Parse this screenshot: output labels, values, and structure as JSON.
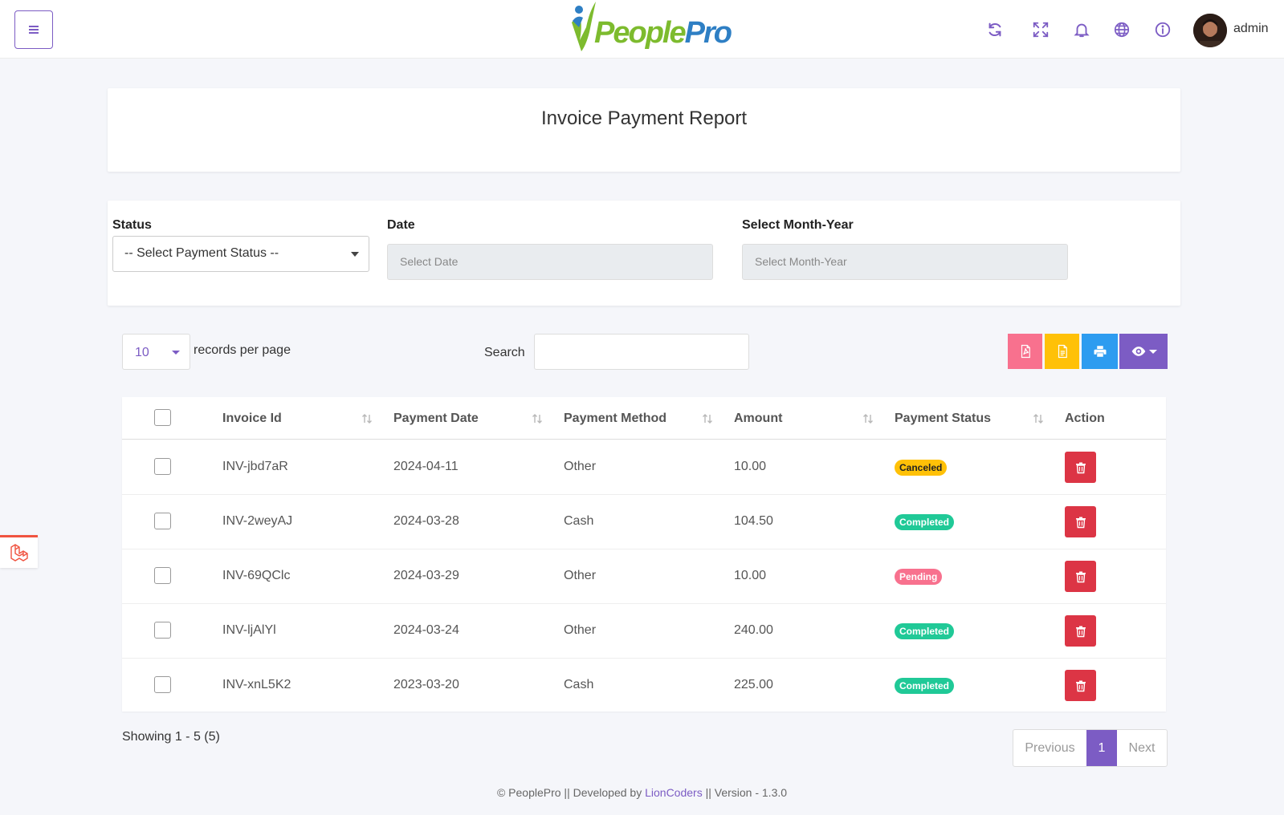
{
  "header": {
    "brand_part1": "People",
    "brand_part2": "Pro",
    "username": "admin",
    "icons": [
      "refresh-icon",
      "fullscreen-icon",
      "bell-icon",
      "globe-icon",
      "info-icon"
    ]
  },
  "page": {
    "title": "Invoice Payment Report"
  },
  "filters": {
    "status_label": "Status",
    "status_value": "-- Select Payment Status --",
    "date_label": "Date",
    "date_placeholder": "Select Date",
    "month_label": "Select Month-Year",
    "month_placeholder": "Select Month-Year"
  },
  "controls": {
    "records_per_page": "10",
    "records_label": "records per page",
    "search_label": "Search",
    "search_value": ""
  },
  "table": {
    "columns": [
      "Invoice Id",
      "Payment Date",
      "Payment Method",
      "Amount",
      "Payment Status",
      "Action"
    ],
    "rows": [
      {
        "id": "INV-jbd7aR",
        "date": "2024-04-11",
        "method": "Other",
        "amount": "10.00",
        "status": "Canceled"
      },
      {
        "id": "INV-2weyAJ",
        "date": "2024-03-28",
        "method": "Cash",
        "amount": "104.50",
        "status": "Completed"
      },
      {
        "id": "INV-69QClc",
        "date": "2024-03-29",
        "method": "Other",
        "amount": "10.00",
        "status": "Pending"
      },
      {
        "id": "INV-ljAlYl",
        "date": "2024-03-24",
        "method": "Other",
        "amount": "240.00",
        "status": "Completed"
      },
      {
        "id": "INV-xnL5K2",
        "date": "2023-03-20",
        "method": "Cash",
        "amount": "225.00",
        "status": "Completed"
      }
    ]
  },
  "status_colors": {
    "Canceled": "#ffc107",
    "Completed": "#20c997",
    "Pending": "#f8718e"
  },
  "toolbar_colors": {
    "pdf": "#f8718e",
    "csv": "#ffc107",
    "print": "#2d9cf0",
    "columns": "#7c5cc4"
  },
  "pagination": {
    "showing": "Showing 1 - 5 (5)",
    "previous": "Previous",
    "current": "1",
    "next": "Next"
  },
  "footer": {
    "prefix": "© PeoplePro || Developed by ",
    "company": "LionCoders",
    "suffix": " || Version - 1.3.0"
  }
}
